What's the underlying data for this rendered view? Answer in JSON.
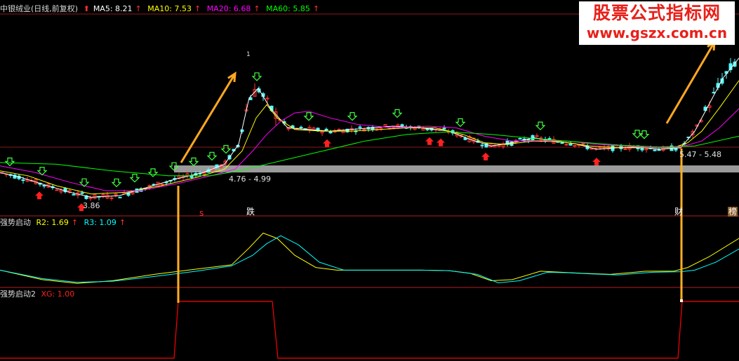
{
  "header": {
    "stock": "中银绒业(日线,前复权)",
    "ma5_label": "MA5: 8.21",
    "ma10_label": "MA10: 7.53",
    "ma20_label": "MA20: 6.68",
    "ma60_label": "MA60: 5.85",
    "ma5_color": "#ffffff",
    "ma10_color": "#ffff00",
    "ma20_color": "#ff00ff",
    "ma60_color": "#00ff00",
    "up_arrow": "↑",
    "up_mark": "⬆"
  },
  "watermark": {
    "line1": "股票公式指标网",
    "line2": "www.gszx.com.cn"
  },
  "main_panel": {
    "price_labels": {
      "low": "3.86",
      "range_left": "4.76 - 4.99",
      "range_right": "5.47 - 5.48",
      "peak_tick": "1"
    },
    "event_tags": {
      "tag_s": "s",
      "tag_die": "跌",
      "tag_cai": "财",
      "tag_bang": "榜"
    }
  },
  "indicator1": {
    "title": "强势启动",
    "r2_label": "R2: 1.69",
    "r3_label": "R3: 1.09",
    "r2_color": "#ffff00",
    "r3_color": "#00ffff"
  },
  "indicator2": {
    "title": "强势启动2",
    "xg_label": "XG: 1.00",
    "xg_color": "#ff0000"
  },
  "chart_data": [
    {
      "type": "line",
      "panel": "price",
      "title": "中银绒业(日线,前复权)",
      "candle_colors": {
        "up": "#ff3232",
        "down": "#54ffff"
      },
      "series": [
        {
          "name": "MA5",
          "color": "#ffffff",
          "points": [
            [
              0,
              4.75
            ],
            [
              30,
              4.6
            ],
            [
              60,
              4.4
            ],
            [
              100,
              4.15
            ],
            [
              130,
              4.0
            ],
            [
              170,
              4.05
            ],
            [
              210,
              4.3
            ],
            [
              250,
              4.55
            ],
            [
              290,
              4.75
            ],
            [
              320,
              5.0
            ],
            [
              340,
              5.6
            ],
            [
              355,
              7.0
            ],
            [
              368,
              7.3
            ],
            [
              385,
              6.7
            ],
            [
              410,
              6.1
            ],
            [
              440,
              6.05
            ],
            [
              470,
              6.0
            ],
            [
              500,
              6.05
            ],
            [
              530,
              6.1
            ],
            [
              560,
              6.15
            ],
            [
              600,
              6.1
            ],
            [
              640,
              6.0
            ],
            [
              670,
              5.75
            ],
            [
              700,
              5.55
            ],
            [
              730,
              5.65
            ],
            [
              760,
              5.8
            ],
            [
              790,
              5.7
            ],
            [
              820,
              5.62
            ],
            [
              850,
              5.45
            ],
            [
              880,
              5.5
            ],
            [
              910,
              5.52
            ],
            [
              940,
              5.45
            ],
            [
              970,
              5.5
            ],
            [
              990,
              6.0
            ],
            [
              1010,
              6.8
            ],
            [
              1030,
              7.6
            ],
            [
              1053,
              8.21
            ]
          ]
        },
        {
          "name": "MA10",
          "color": "#ffff00",
          "points": [
            [
              0,
              4.8
            ],
            [
              40,
              4.65
            ],
            [
              80,
              4.35
            ],
            [
              130,
              4.1
            ],
            [
              180,
              4.15
            ],
            [
              230,
              4.35
            ],
            [
              280,
              4.6
            ],
            [
              320,
              4.85
            ],
            [
              345,
              5.4
            ],
            [
              365,
              6.4
            ],
            [
              380,
              6.8
            ],
            [
              395,
              6.4
            ],
            [
              420,
              6.05
            ],
            [
              460,
              6.0
            ],
            [
              500,
              6.0
            ],
            [
              540,
              6.05
            ],
            [
              580,
              6.1
            ],
            [
              620,
              6.1
            ],
            [
              660,
              5.9
            ],
            [
              690,
              5.65
            ],
            [
              720,
              5.6
            ],
            [
              760,
              5.7
            ],
            [
              800,
              5.68
            ],
            [
              840,
              5.55
            ],
            [
              880,
              5.5
            ],
            [
              920,
              5.5
            ],
            [
              960,
              5.5
            ],
            [
              980,
              5.65
            ],
            [
              1000,
              6.0
            ],
            [
              1025,
              6.7
            ],
            [
              1053,
              7.53
            ]
          ]
        },
        {
          "name": "MA20",
          "color": "#ff00ff",
          "points": [
            [
              0,
              4.95
            ],
            [
              50,
              4.75
            ],
            [
              100,
              4.45
            ],
            [
              150,
              4.2
            ],
            [
              200,
              4.2
            ],
            [
              250,
              4.4
            ],
            [
              300,
              4.65
            ],
            [
              335,
              4.85
            ],
            [
              360,
              5.4
            ],
            [
              380,
              5.9
            ],
            [
              400,
              6.3
            ],
            [
              420,
              6.55
            ],
            [
              440,
              6.6
            ],
            [
              470,
              6.4
            ],
            [
              510,
              6.2
            ],
            [
              560,
              6.1
            ],
            [
              610,
              6.15
            ],
            [
              650,
              6.1
            ],
            [
              690,
              5.85
            ],
            [
              730,
              5.7
            ],
            [
              770,
              5.72
            ],
            [
              810,
              5.7
            ],
            [
              850,
              5.6
            ],
            [
              890,
              5.55
            ],
            [
              930,
              5.5
            ],
            [
              970,
              5.52
            ],
            [
              1000,
              5.7
            ],
            [
              1025,
              6.1
            ],
            [
              1053,
              6.68
            ]
          ]
        },
        {
          "name": "MA60",
          "color": "#00ff00",
          "points": [
            [
              0,
              5.05
            ],
            [
              80,
              5.0
            ],
            [
              160,
              4.8
            ],
            [
              240,
              4.65
            ],
            [
              300,
              4.65
            ],
            [
              340,
              4.8
            ],
            [
              400,
              5.1
            ],
            [
              460,
              5.4
            ],
            [
              520,
              5.7
            ],
            [
              580,
              5.9
            ],
            [
              640,
              5.98
            ],
            [
              700,
              5.9
            ],
            [
              760,
              5.78
            ],
            [
              820,
              5.68
            ],
            [
              880,
              5.58
            ],
            [
              940,
              5.52
            ],
            [
              990,
              5.55
            ],
            [
              1053,
              5.85
            ]
          ]
        }
      ],
      "ylim": [
        3.5,
        9.5
      ]
    },
    {
      "type": "line",
      "panel": "indicator",
      "title": "强势启动",
      "series": [
        {
          "name": "R2",
          "color": "#ffff00",
          "points": [
            [
              0,
              0.3
            ],
            [
              60,
              0.12
            ],
            [
              110,
              0.05
            ],
            [
              160,
              0.1
            ],
            [
              220,
              0.22
            ],
            [
              280,
              0.32
            ],
            [
              330,
              0.4
            ],
            [
              355,
              0.72
            ],
            [
              375,
              1.0
            ],
            [
              395,
              0.9
            ],
            [
              420,
              0.58
            ],
            [
              450,
              0.35
            ],
            [
              480,
              0.3
            ],
            [
              540,
              0.3
            ],
            [
              600,
              0.3
            ],
            [
              640,
              0.29
            ],
            [
              670,
              0.24
            ],
            [
              700,
              0.1
            ],
            [
              730,
              0.12
            ],
            [
              770,
              0.28
            ],
            [
              800,
              0.26
            ],
            [
              830,
              0.24
            ],
            [
              870,
              0.22
            ],
            [
              920,
              0.28
            ],
            [
              960,
              0.28
            ],
            [
              980,
              0.35
            ],
            [
              1010,
              0.55
            ],
            [
              1053,
              0.9
            ]
          ]
        },
        {
          "name": "R3",
          "color": "#00ffff",
          "points": [
            [
              0,
              0.3
            ],
            [
              60,
              0.14
            ],
            [
              110,
              0.07
            ],
            [
              160,
              0.09
            ],
            [
              220,
              0.18
            ],
            [
              280,
              0.28
            ],
            [
              330,
              0.38
            ],
            [
              360,
              0.58
            ],
            [
              380,
              0.8
            ],
            [
              400,
              0.95
            ],
            [
              425,
              0.78
            ],
            [
              455,
              0.45
            ],
            [
              490,
              0.3
            ],
            [
              540,
              0.3
            ],
            [
              600,
              0.3
            ],
            [
              640,
              0.29
            ],
            [
              680,
              0.22
            ],
            [
              710,
              0.06
            ],
            [
              740,
              0.1
            ],
            [
              780,
              0.26
            ],
            [
              810,
              0.25
            ],
            [
              840,
              0.23
            ],
            [
              880,
              0.21
            ],
            [
              930,
              0.26
            ],
            [
              970,
              0.27
            ],
            [
              990,
              0.3
            ],
            [
              1020,
              0.45
            ],
            [
              1053,
              0.7
            ]
          ]
        }
      ],
      "ylim": [
        0,
        1.1
      ]
    },
    {
      "type": "line",
      "panel": "indicator",
      "title": "强势启动2",
      "series": [
        {
          "name": "XG",
          "color": "#ff0000",
          "points": [
            [
              0,
              0
            ],
            [
              248,
              0
            ],
            [
              254,
              1
            ],
            [
              388,
              1
            ],
            [
              396,
              0
            ],
            [
              966,
              0
            ],
            [
              972,
              1
            ],
            [
              1053,
              1
            ]
          ]
        }
      ],
      "ylim": [
        0,
        1
      ]
    }
  ]
}
